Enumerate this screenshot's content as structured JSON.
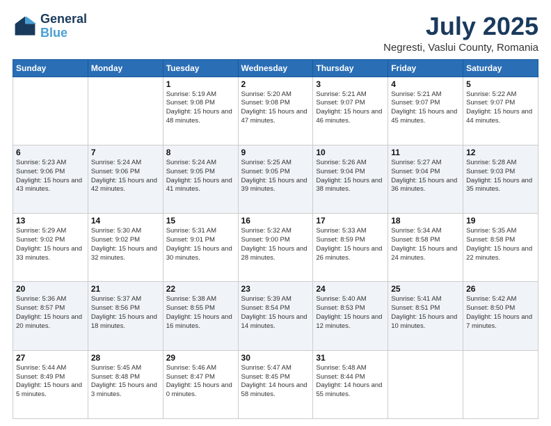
{
  "logo": {
    "line1": "General",
    "line2": "Blue"
  },
  "title": "July 2025",
  "subtitle": "Negresti, Vaslui County, Romania",
  "days_header": [
    "Sunday",
    "Monday",
    "Tuesday",
    "Wednesday",
    "Thursday",
    "Friday",
    "Saturday"
  ],
  "weeks": [
    [
      {
        "day": "",
        "text": ""
      },
      {
        "day": "",
        "text": ""
      },
      {
        "day": "1",
        "text": "Sunrise: 5:19 AM\nSunset: 9:08 PM\nDaylight: 15 hours and 48 minutes."
      },
      {
        "day": "2",
        "text": "Sunrise: 5:20 AM\nSunset: 9:08 PM\nDaylight: 15 hours and 47 minutes."
      },
      {
        "day": "3",
        "text": "Sunrise: 5:21 AM\nSunset: 9:07 PM\nDaylight: 15 hours and 46 minutes."
      },
      {
        "day": "4",
        "text": "Sunrise: 5:21 AM\nSunset: 9:07 PM\nDaylight: 15 hours and 45 minutes."
      },
      {
        "day": "5",
        "text": "Sunrise: 5:22 AM\nSunset: 9:07 PM\nDaylight: 15 hours and 44 minutes."
      }
    ],
    [
      {
        "day": "6",
        "text": "Sunrise: 5:23 AM\nSunset: 9:06 PM\nDaylight: 15 hours and 43 minutes."
      },
      {
        "day": "7",
        "text": "Sunrise: 5:24 AM\nSunset: 9:06 PM\nDaylight: 15 hours and 42 minutes."
      },
      {
        "day": "8",
        "text": "Sunrise: 5:24 AM\nSunset: 9:05 PM\nDaylight: 15 hours and 41 minutes."
      },
      {
        "day": "9",
        "text": "Sunrise: 5:25 AM\nSunset: 9:05 PM\nDaylight: 15 hours and 39 minutes."
      },
      {
        "day": "10",
        "text": "Sunrise: 5:26 AM\nSunset: 9:04 PM\nDaylight: 15 hours and 38 minutes."
      },
      {
        "day": "11",
        "text": "Sunrise: 5:27 AM\nSunset: 9:04 PM\nDaylight: 15 hours and 36 minutes."
      },
      {
        "day": "12",
        "text": "Sunrise: 5:28 AM\nSunset: 9:03 PM\nDaylight: 15 hours and 35 minutes."
      }
    ],
    [
      {
        "day": "13",
        "text": "Sunrise: 5:29 AM\nSunset: 9:02 PM\nDaylight: 15 hours and 33 minutes."
      },
      {
        "day": "14",
        "text": "Sunrise: 5:30 AM\nSunset: 9:02 PM\nDaylight: 15 hours and 32 minutes."
      },
      {
        "day": "15",
        "text": "Sunrise: 5:31 AM\nSunset: 9:01 PM\nDaylight: 15 hours and 30 minutes."
      },
      {
        "day": "16",
        "text": "Sunrise: 5:32 AM\nSunset: 9:00 PM\nDaylight: 15 hours and 28 minutes."
      },
      {
        "day": "17",
        "text": "Sunrise: 5:33 AM\nSunset: 8:59 PM\nDaylight: 15 hours and 26 minutes."
      },
      {
        "day": "18",
        "text": "Sunrise: 5:34 AM\nSunset: 8:58 PM\nDaylight: 15 hours and 24 minutes."
      },
      {
        "day": "19",
        "text": "Sunrise: 5:35 AM\nSunset: 8:58 PM\nDaylight: 15 hours and 22 minutes."
      }
    ],
    [
      {
        "day": "20",
        "text": "Sunrise: 5:36 AM\nSunset: 8:57 PM\nDaylight: 15 hours and 20 minutes."
      },
      {
        "day": "21",
        "text": "Sunrise: 5:37 AM\nSunset: 8:56 PM\nDaylight: 15 hours and 18 minutes."
      },
      {
        "day": "22",
        "text": "Sunrise: 5:38 AM\nSunset: 8:55 PM\nDaylight: 15 hours and 16 minutes."
      },
      {
        "day": "23",
        "text": "Sunrise: 5:39 AM\nSunset: 8:54 PM\nDaylight: 15 hours and 14 minutes."
      },
      {
        "day": "24",
        "text": "Sunrise: 5:40 AM\nSunset: 8:53 PM\nDaylight: 15 hours and 12 minutes."
      },
      {
        "day": "25",
        "text": "Sunrise: 5:41 AM\nSunset: 8:51 PM\nDaylight: 15 hours and 10 minutes."
      },
      {
        "day": "26",
        "text": "Sunrise: 5:42 AM\nSunset: 8:50 PM\nDaylight: 15 hours and 7 minutes."
      }
    ],
    [
      {
        "day": "27",
        "text": "Sunrise: 5:44 AM\nSunset: 8:49 PM\nDaylight: 15 hours and 5 minutes."
      },
      {
        "day": "28",
        "text": "Sunrise: 5:45 AM\nSunset: 8:48 PM\nDaylight: 15 hours and 3 minutes."
      },
      {
        "day": "29",
        "text": "Sunrise: 5:46 AM\nSunset: 8:47 PM\nDaylight: 15 hours and 0 minutes."
      },
      {
        "day": "30",
        "text": "Sunrise: 5:47 AM\nSunset: 8:45 PM\nDaylight: 14 hours and 58 minutes."
      },
      {
        "day": "31",
        "text": "Sunrise: 5:48 AM\nSunset: 8:44 PM\nDaylight: 14 hours and 55 minutes."
      },
      {
        "day": "",
        "text": ""
      },
      {
        "day": "",
        "text": ""
      }
    ]
  ]
}
